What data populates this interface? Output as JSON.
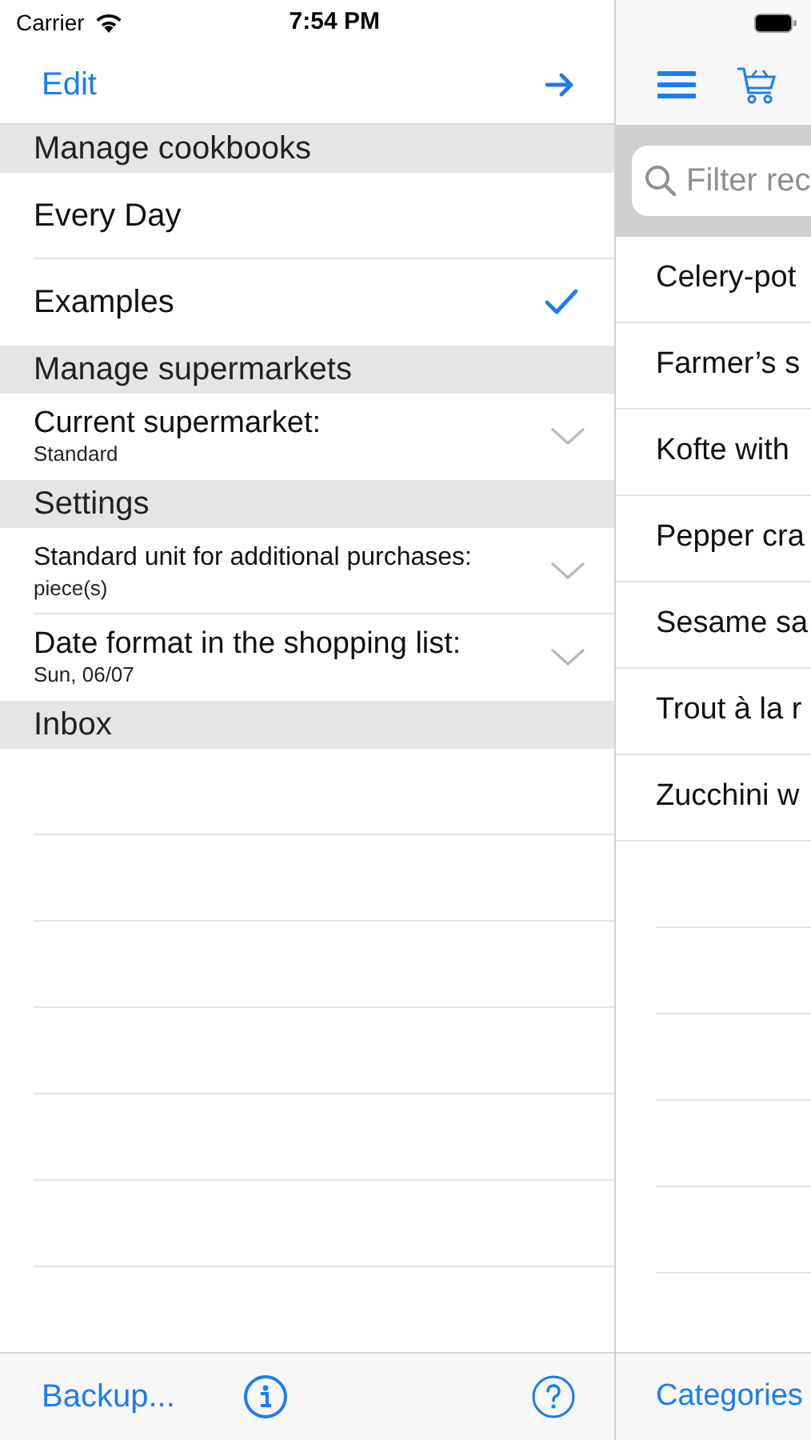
{
  "status_bar": {
    "carrier": "Carrier",
    "time": "7:54 PM"
  },
  "left_panel": {
    "nav": {
      "edit": "Edit"
    },
    "sections": [
      {
        "title": "Manage cookbooks",
        "rows": [
          {
            "kind": "choice",
            "label": "Every Day",
            "selected": false
          },
          {
            "kind": "choice",
            "label": "Examples",
            "selected": true
          }
        ]
      },
      {
        "title": "Manage supermarkets",
        "rows": [
          {
            "kind": "picker",
            "label": "Current supermarket:",
            "value": "Standard"
          }
        ]
      },
      {
        "title": "Settings",
        "rows": [
          {
            "kind": "picker",
            "label": "Standard unit for additional purchases:",
            "value": "piece(s)"
          },
          {
            "kind": "picker",
            "label": "Date format in the shopping list:",
            "value": "Sun, 06/07"
          }
        ]
      },
      {
        "title": "Inbox"
      }
    ],
    "toolbar": {
      "backup": "Backup..."
    }
  },
  "right_panel": {
    "search": {
      "placeholder": "Filter rec"
    },
    "recipes": [
      "Celery-pot",
      "Farmer’s s",
      "Kofte with",
      "Pepper cra",
      "Sesame sa",
      "Trout à la r",
      "Zucchini w"
    ],
    "toolbar": {
      "categories": "Categories"
    }
  }
}
